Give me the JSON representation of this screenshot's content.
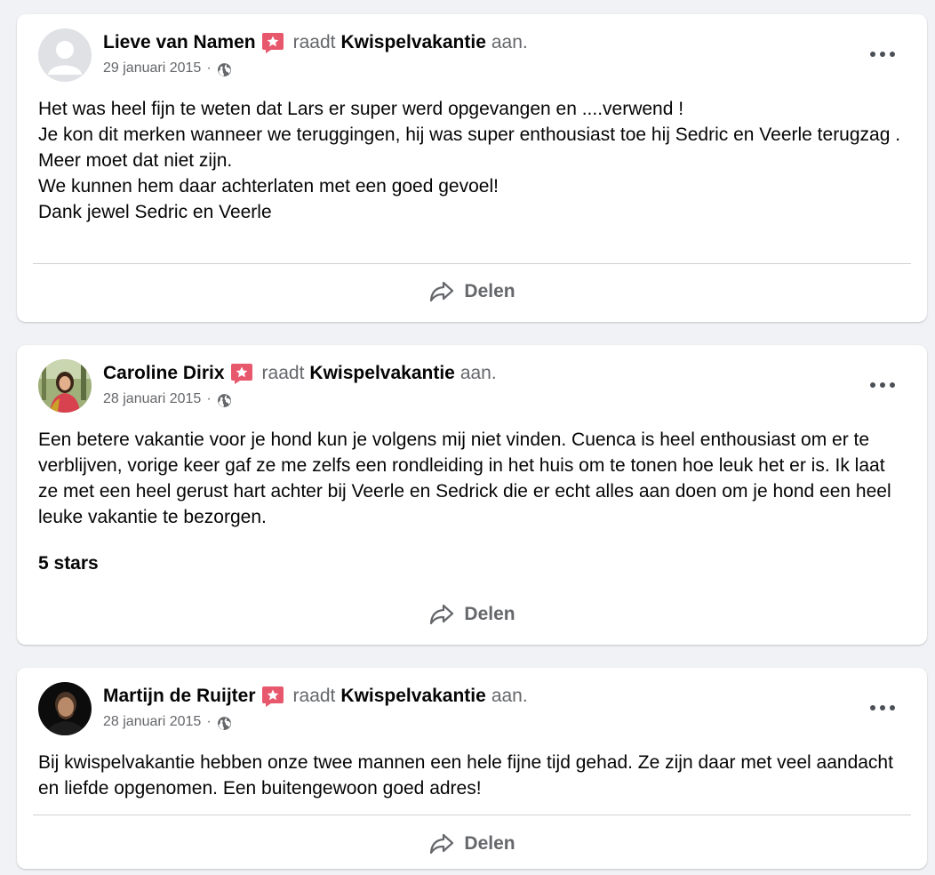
{
  "reviews": [
    {
      "author": "Lieve van Namen",
      "verb": "raadt",
      "page": "Kwispelvakantie",
      "tail": "aan.",
      "date": "29 januari 2015",
      "sep": "·",
      "avatar_icon": "default-user-avatar",
      "lines": [
        "Het was heel fijn te weten dat Lars er super werd opgevangen en ....verwend !",
        "Je kon dit merken wanneer we teruggingen, hij was super enthousiast toe hij Sedric en Veerle terugzag .",
        "Meer moet dat niet zijn.",
        "We kunnen hem daar achterlaten met een goed gevoel!",
        "Dank jewel Sedric en Veerle"
      ],
      "share_label": "Delen"
    },
    {
      "author": "Caroline Dirix",
      "verb": "raadt",
      "page": "Kwispelvakantie",
      "tail": "aan.",
      "date": "28 januari 2015",
      "sep": "·",
      "avatar_icon": "profile-photo",
      "lines": [
        "Een betere vakantie voor je hond kun je volgens mij niet vinden.  Cuenca is heel enthousiast om er te verblijven, vorige keer gaf ze me zelfs een rondleiding in het huis om te tonen hoe leuk het er is.  Ik laat ze met een heel gerust hart achter bij Veerle en Sedrick die er echt alles aan doen om je hond een heel leuke vakantie te bezorgen."
      ],
      "stars": "5 stars",
      "share_label": "Delen"
    },
    {
      "author": "Martijn de Ruijter",
      "verb": "raadt",
      "page": "Kwispelvakantie",
      "tail": "aan.",
      "date": "28 januari 2015",
      "sep": "·",
      "avatar_icon": "profile-photo",
      "lines": [
        "Bij kwispelvakantie hebben onze twee mannen een hele fijne tijd gehad. Ze zijn daar met veel aandacht en liefde opgenomen. Een buitengewoon goed adres!"
      ],
      "share_label": "Delen"
    }
  ],
  "colors": {
    "background": "#f0f2f5",
    "card": "#ffffff",
    "primary_text": "#050505",
    "secondary_text": "#65676b",
    "recommend_badge": "#e8586c",
    "divider": "#ced0d4"
  },
  "icons": {
    "badge": "recommend-star-icon",
    "privacy": "globe-icon",
    "menu": "more-options-icon",
    "share": "share-arrow-icon"
  }
}
